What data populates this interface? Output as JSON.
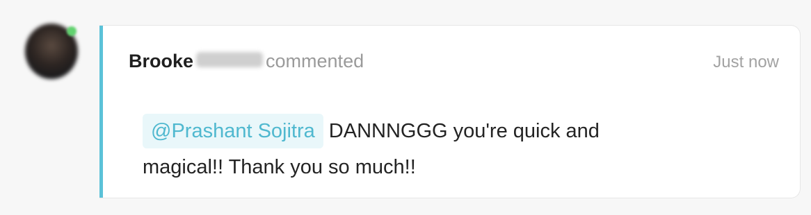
{
  "comment": {
    "author_first_name": "Brooke",
    "action": "commented",
    "timestamp": "Just now",
    "mention": "@Prashant Sojitra",
    "text_part1": "DANNNGGG you're quick and",
    "text_part2": "magical!! Thank you so much!!"
  },
  "colors": {
    "accent": "#5bc2d8",
    "mention_text": "#4fb8cf",
    "mention_bg": "#e9f7fa",
    "presence": "#62d26f"
  },
  "icons": {
    "presence": "online-status-dot"
  }
}
